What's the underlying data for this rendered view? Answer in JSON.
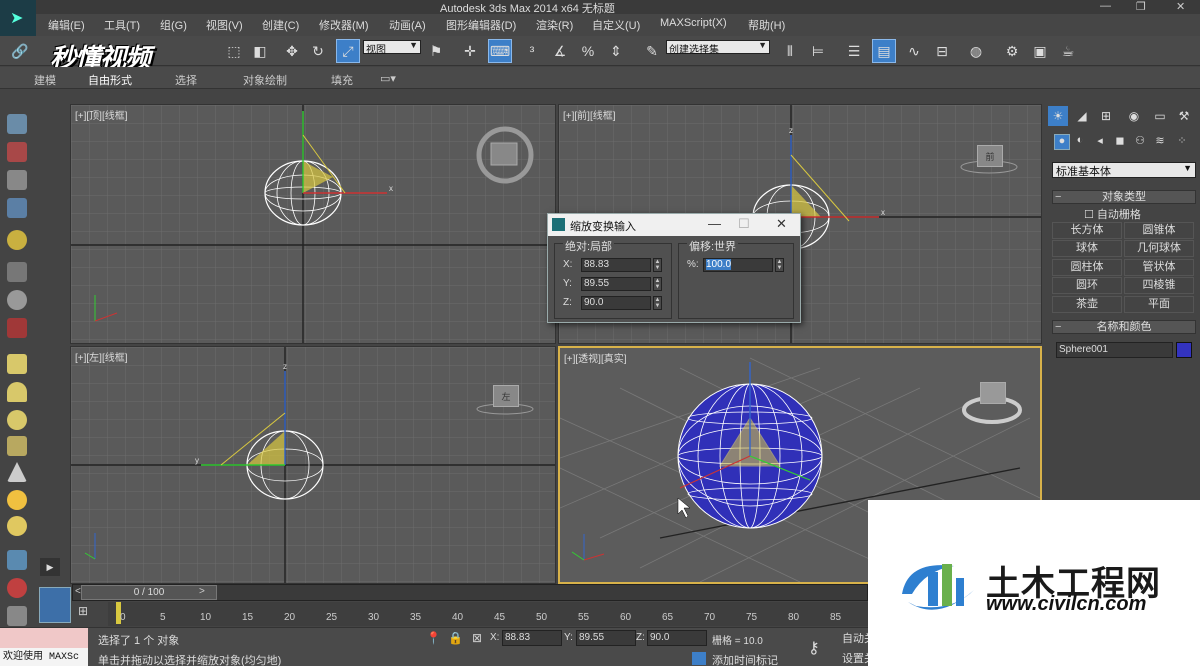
{
  "window": {
    "title": "Autodesk 3ds Max  2014 x64      无标题",
    "controls": [
      "—",
      "❐",
      "✕"
    ]
  },
  "menu": [
    "编辑(E)",
    "工具(T)",
    "组(G)",
    "视图(V)",
    "创建(C)",
    "修改器(M)",
    "动画(A)",
    "图形编辑器(D)",
    "渲染(R)",
    "自定义(U)",
    "MAXScript(X)",
    "帮助(H)"
  ],
  "toolbar": {
    "view_select": "视图",
    "selection_set": "创建选择集",
    "watermark": "秒懂视频"
  },
  "ribbon": {
    "tabs": [
      "建模",
      "自由形式",
      "选择",
      "对象绘制",
      "填充"
    ]
  },
  "viewports": [
    {
      "label": "[+][顶][线框]",
      "cube": "顶"
    },
    {
      "label": "[+][前][线框]",
      "cube": "前"
    },
    {
      "label": "[+][左][线框]",
      "cube": "左"
    },
    {
      "label": "[+][透视][真实]",
      "cube": ""
    }
  ],
  "dialog": {
    "title": "缩放变换输入",
    "absolute_group": "绝对:局部",
    "offset_group": "偏移:世界",
    "x_label": "X:",
    "x_value": "88.83",
    "y_label": "Y:",
    "y_value": "89.55",
    "z_label": "Z:",
    "z_value": "90.0",
    "pct_label": "%:",
    "pct_value": "100.0"
  },
  "command_panel": {
    "dropdown": "标准基本体",
    "object_type_header": "对象类型",
    "autogrid": "自动栅格",
    "buttons": [
      "长方体",
      "圆锥体",
      "球体",
      "几何球体",
      "圆柱体",
      "管状体",
      "圆环",
      "四棱锥",
      "茶壶",
      "平面"
    ],
    "name_color_header": "名称和颜色",
    "object_name": "Sphere001",
    "object_color": "#3333c0"
  },
  "timeline": {
    "frame": "0 / 100",
    "ticks": [
      "0",
      "5",
      "10",
      "15",
      "20",
      "25",
      "30",
      "35",
      "40",
      "45",
      "50",
      "55",
      "60",
      "65",
      "70",
      "75",
      "80",
      "85"
    ]
  },
  "status": {
    "maxscript": "欢迎使用 MAXSc",
    "selected": "选择了 1 个 对象",
    "prompt": "单击并拖动以选择并缩放对象(均匀地)",
    "x_label": "X:",
    "x": "88.83",
    "y_label": "Y:",
    "y": "89.55",
    "z_label": "Z:",
    "z": "90.0",
    "grid": "栅格 = 10.0",
    "add_time_tag": "添加时间标记",
    "autokey": "自动关",
    "setkey": "设置关"
  },
  "site_watermark": {
    "name": "土木工程网",
    "url": "www.civilcn.com"
  },
  "colors": {
    "accent": "#3d7fc8",
    "active_viewport_border": "#d8b24a",
    "sphere": "#3333c0"
  }
}
